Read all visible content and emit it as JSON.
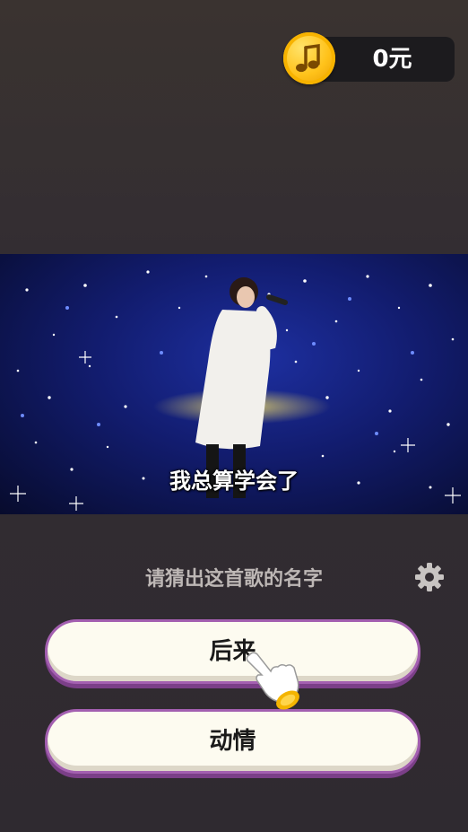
{
  "header": {
    "coin_icon": "music-note-coin-icon",
    "balance": "0元"
  },
  "video": {
    "subtitle": "我总算学会了"
  },
  "quiz": {
    "prompt": "请猜出这首歌的名字",
    "settings_icon": "gear-icon",
    "options": [
      {
        "label": "后来"
      },
      {
        "label": "动情"
      }
    ],
    "hint_icon": "pointing-hand-icon"
  }
}
